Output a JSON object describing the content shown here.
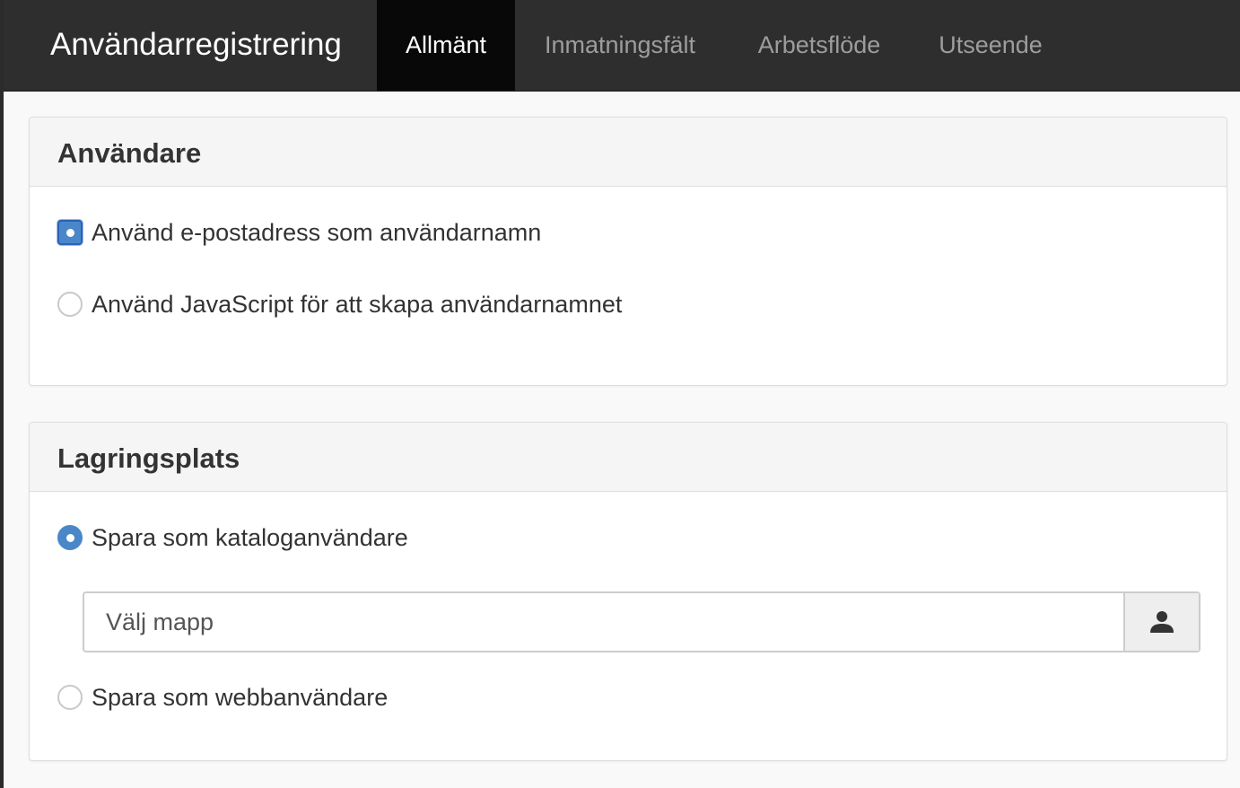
{
  "header": {
    "title": "Användarregistrering",
    "tabs": [
      {
        "label": "Allmänt",
        "active": true
      },
      {
        "label": "Inmatningsfält",
        "active": false
      },
      {
        "label": "Arbetsflöde",
        "active": false
      },
      {
        "label": "Utseende",
        "active": false
      }
    ]
  },
  "users_panel": {
    "heading": "Användare",
    "options": [
      {
        "label": "Använd e-postadress som användarnamn",
        "checked": true
      },
      {
        "label": "Använd JavaScript för att skapa användarnamnet",
        "checked": false
      }
    ]
  },
  "storage_panel": {
    "heading": "Lagringsplats",
    "options": [
      {
        "label": "Spara som kataloganvändare",
        "checked": true
      },
      {
        "label": "Spara som webbanvändare",
        "checked": false
      }
    ],
    "folder_placeholder": "Välj mapp",
    "folder_button_icon": "user-icon"
  },
  "colors": {
    "navbar": "#2e2e2e",
    "active_tab": "#080808",
    "accent": "#4a87c8"
  }
}
